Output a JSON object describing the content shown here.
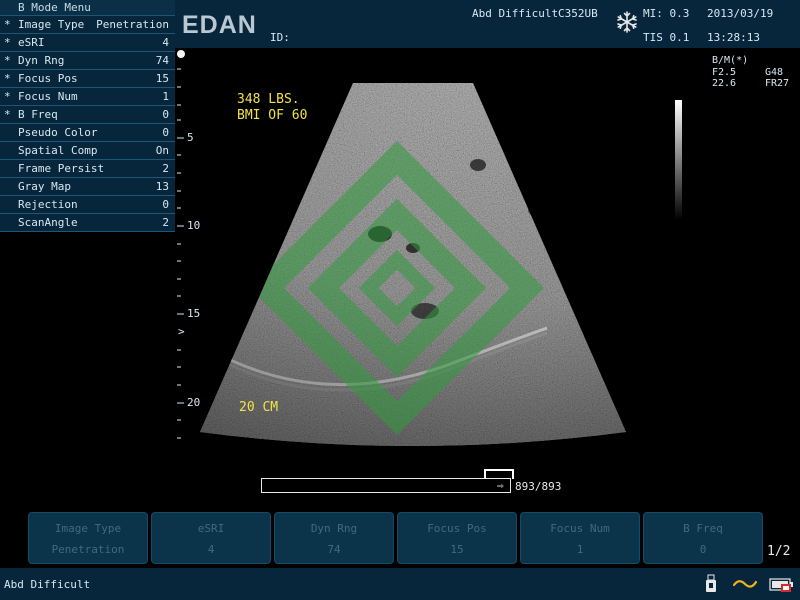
{
  "menu": {
    "title": "B Mode Menu",
    "items": [
      {
        "mark": "*",
        "label": "Image Type",
        "value": "Penetration"
      },
      {
        "mark": "*",
        "label": "eSRI",
        "value": "4"
      },
      {
        "mark": "*",
        "label": "Dyn Rng",
        "value": "74"
      },
      {
        "mark": "*",
        "label": "Focus Pos",
        "value": "15"
      },
      {
        "mark": "*",
        "label": "Focus Num",
        "value": "1"
      },
      {
        "mark": "*",
        "label": "B Freq",
        "value": "0"
      },
      {
        "mark": "",
        "label": "Pseudo Color",
        "value": "0"
      },
      {
        "mark": "",
        "label": "Spatial Comp",
        "value": "On"
      },
      {
        "mark": "",
        "label": "Frame Persist",
        "value": "2"
      },
      {
        "mark": "",
        "label": "Gray Map",
        "value": "13"
      },
      {
        "mark": "",
        "label": "Rejection",
        "value": "0"
      },
      {
        "mark": "",
        "label": "ScanAngle",
        "value": "2"
      }
    ]
  },
  "header": {
    "logo": "EDAN",
    "id_label": "ID:",
    "exam": "Abd Difficult",
    "probe": "C352UB",
    "mi": "MI: 0.3",
    "tis": "TIS 0.1",
    "date": "2013/03/19",
    "time": "13:28:13",
    "freeze_icon": "snowflake-icon"
  },
  "image": {
    "annotation_line1": "348 LBS.",
    "annotation_line2": "BMI OF 60",
    "depth_annotation": "20 CM",
    "depth_labels": [
      "5",
      "10",
      "15",
      "20"
    ],
    "focus_marker": ">",
    "params": {
      "mode": "B/M(*)",
      "freq": "F2.5",
      "gain": "G48",
      "depth": "22.6",
      "frame_rate": "FR27"
    }
  },
  "cine": {
    "count": "893/893"
  },
  "softbuttons": [
    {
      "title": "Image Type",
      "value": "Penetration"
    },
    {
      "title": "eSRI",
      "value": "4"
    },
    {
      "title": "Dyn Rng",
      "value": "74"
    },
    {
      "title": "Focus Pos",
      "value": "15"
    },
    {
      "title": "Focus Num",
      "value": "1"
    },
    {
      "title": "B Freq",
      "value": "0"
    }
  ],
  "pager": "1/2",
  "statusbar": {
    "exam": "Abd Difficult",
    "icons": [
      "usb-drive-icon",
      "wave-icon",
      "battery-icon"
    ]
  },
  "colors": {
    "panel": "#08263b",
    "annotation": "#f1e24a",
    "watermark": "#2f9a3e"
  }
}
